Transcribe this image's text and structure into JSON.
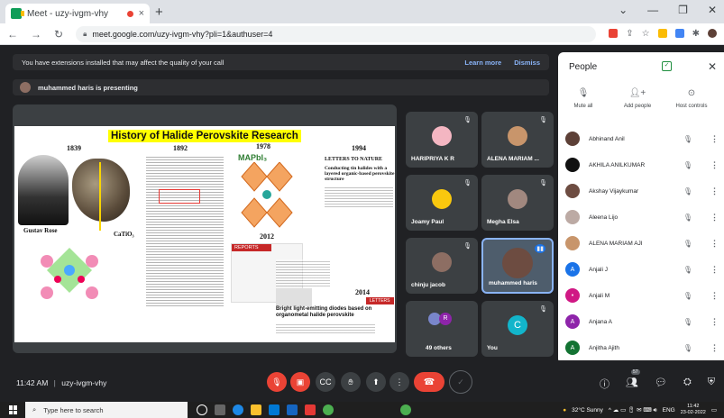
{
  "browser": {
    "tab_title": "Meet - uzy-ivgm-vhy",
    "tab_close": "×",
    "new_tab": "+",
    "url": "meet.google.com/uzy-ivgm-vhy?pli=1&authuser=4",
    "window_controls": [
      "⌄",
      "—",
      "❐",
      "✕"
    ]
  },
  "meet": {
    "extension_warning": "You have extensions installed that may affect the quality of your call",
    "learn_more": "Learn more",
    "dismiss": "Dismiss",
    "presenter_banner": "muhammed haris is presenting",
    "meeting_time": "11:42 AM",
    "meeting_code": "uzy-ivgm-vhy",
    "separator": "|"
  },
  "slide": {
    "title": "History of Halide Perovskite Research",
    "years": [
      "1839",
      "1892",
      "1978",
      "1994",
      "2012",
      "2014"
    ],
    "gustav": "Gustav Rose",
    "catio3": "CaTiO₃",
    "mapbi3": "MAPbI₃",
    "letters": "LETTERS TO NATURE",
    "conducting": "Conducting tin halides with a layered organic-based perovskite structure",
    "reports": "REPORTS",
    "bright": "Bright light-emitting diodes based on organometal halide perovskite",
    "letters2": "LETTERS"
  },
  "tiles": [
    {
      "name": "HARIPRIYA K R",
      "color": "#f4b6c2"
    },
    {
      "name": "ALENA MARIAM ...",
      "color": "#c8956b"
    },
    {
      "name": "Joamy Paul",
      "color": "#f9c80e"
    },
    {
      "name": "Megha Elsa",
      "color": "#a1887f"
    },
    {
      "name": "chinju jacob",
      "color": "#8d6e63"
    },
    {
      "name": "muhammed haris",
      "color": "#6d4c41"
    },
    {
      "name": "49 others",
      "color": "#7986cb"
    },
    {
      "name": "You",
      "color": "#12b5cb"
    }
  ],
  "others_badge": "R",
  "you_initial": "C",
  "people": {
    "title": "People",
    "close": "✕",
    "actions": [
      "Mute all",
      "Add people",
      "Host controls"
    ],
    "list": [
      {
        "name": "Abhinand Anil",
        "initial": "",
        "color": "#5d4037"
      },
      {
        "name": "AKHILA ANILKUMAR",
        "initial": "",
        "color": "#111111"
      },
      {
        "name": "Akshay Vijaykumar",
        "initial": "",
        "color": "#6d4c41"
      },
      {
        "name": "Aleena Lijo",
        "initial": "",
        "color": "#bcaaa4"
      },
      {
        "name": "ALENA MARIAM AJI",
        "initial": "",
        "color": "#c8956b"
      },
      {
        "name": "Anjali J",
        "initial": "A",
        "color": "#1a73e8"
      },
      {
        "name": "Anjali M",
        "initial": "•",
        "color": "#d01884"
      },
      {
        "name": "Anjana A",
        "initial": "A",
        "color": "#8e24aa"
      },
      {
        "name": "Anjitha Ajith",
        "initial": "A",
        "color": "#137333"
      }
    ],
    "more": "⋮"
  },
  "bottom": {
    "participants_count": "57"
  },
  "taskbar": {
    "search_placeholder": "Type here to search",
    "weather": "32°C  Sunny",
    "lang": "ENG",
    "time": "11:42",
    "date": "23-02-2022"
  }
}
